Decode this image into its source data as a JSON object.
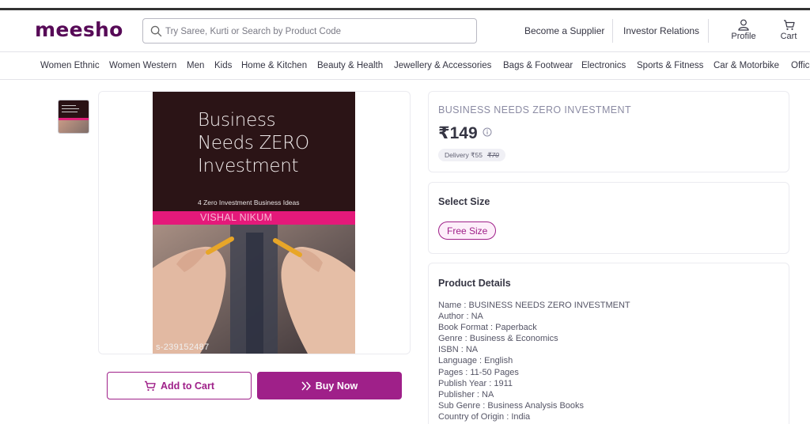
{
  "header": {
    "logo": "meesho",
    "search_placeholder": "Try Saree, Kurti or Search by Product Code",
    "links": [
      "Become a Supplier",
      "Investor Relations"
    ],
    "profile_label": "Profile",
    "cart_label": "Cart"
  },
  "nav": {
    "categories": [
      "Women Ethnic",
      "Women Western",
      "Men",
      "Kids",
      "Home & Kitchen",
      "Beauty & Health",
      "Jewellery & Accessories",
      "Bags & Footwear",
      "Electronics",
      "Sports & Fitness",
      "Car & Motorbike",
      "Office"
    ]
  },
  "product_image": {
    "cover_title_lines": [
      "Business",
      "Needs ZERO",
      "Investment"
    ],
    "cover_subtitle": "4 Zero Investment Business Ideas",
    "cover_author": "VISHAL NIKUM",
    "sku": "s-239152487"
  },
  "actions": {
    "add_to_cart": "Add to Cart",
    "buy_now": "Buy Now"
  },
  "product": {
    "title": "BUSINESS NEEDS ZERO INVESTMENT",
    "price": "₹149",
    "delivery_label": "Delivery ₹55",
    "delivery_original": "₹70"
  },
  "size": {
    "heading": "Select Size",
    "option": "Free Size"
  },
  "details": {
    "heading": "Product Details",
    "lines": [
      "Name : BUSINESS NEEDS ZERO INVESTMENT",
      "Author : NA",
      "Book Format : Paperback",
      "Genre : Business & Economics",
      "ISBN : NA",
      "Language : English",
      "Pages : 11-50 Pages",
      "Publish Year : 1911",
      "Publisher : NA",
      "Sub Genre : Business Analysis Books",
      "Country of Origin : India"
    ]
  },
  "colors": {
    "brand": "#570a57",
    "accent": "#9f2089",
    "cover_pink": "#e4197a"
  }
}
